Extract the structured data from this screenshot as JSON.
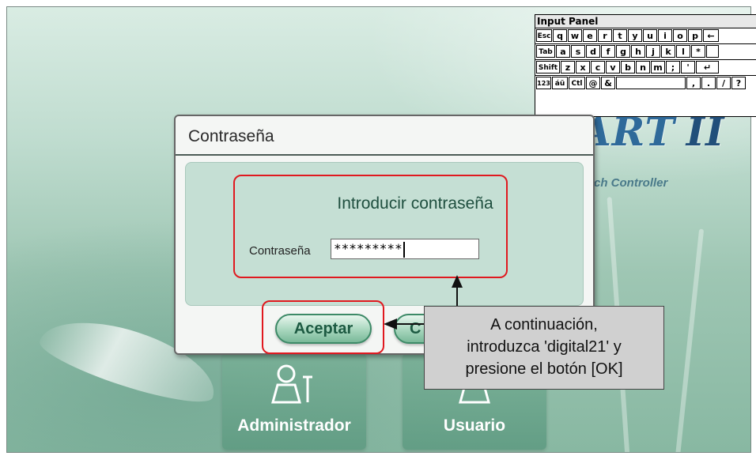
{
  "input_panel": {
    "title": "Input Panel",
    "rows": [
      [
        "Esc",
        "q",
        "w",
        "e",
        "r",
        "t",
        "y",
        "u",
        "i",
        "o",
        "p",
        "←"
      ],
      [
        "Tab",
        "a",
        "s",
        "d",
        "f",
        "g",
        "h",
        "j",
        "k",
        "l",
        "*",
        ""
      ],
      [
        "Shift",
        "z",
        "x",
        "c",
        "v",
        "b",
        "n",
        "m",
        ";",
        "'",
        "↵"
      ],
      [
        "123",
        "áü",
        "Ctl",
        "@",
        "&",
        "",
        ",",
        ".",
        "/",
        "?"
      ]
    ]
  },
  "background": {
    "logo_text": "ART",
    "logo_numeral": "II",
    "logo_subtitle": "ch Controller",
    "tiles": [
      {
        "label": "Administrador",
        "icon": "admin-icon"
      },
      {
        "label": "Usuario",
        "icon": "user-icon"
      }
    ]
  },
  "dialog": {
    "title": "Contraseña",
    "prompt": "Introducir contraseña",
    "password_label": "Contraseña",
    "password_value": "*********",
    "accept_label": "Aceptar",
    "cancel_label_partial": "C"
  },
  "annotation": {
    "callout_lines": [
      "A continuación,",
      "introduzca 'digital21' y",
      "presione el botón [OK]"
    ],
    "highlight_color": "#e0191f"
  }
}
